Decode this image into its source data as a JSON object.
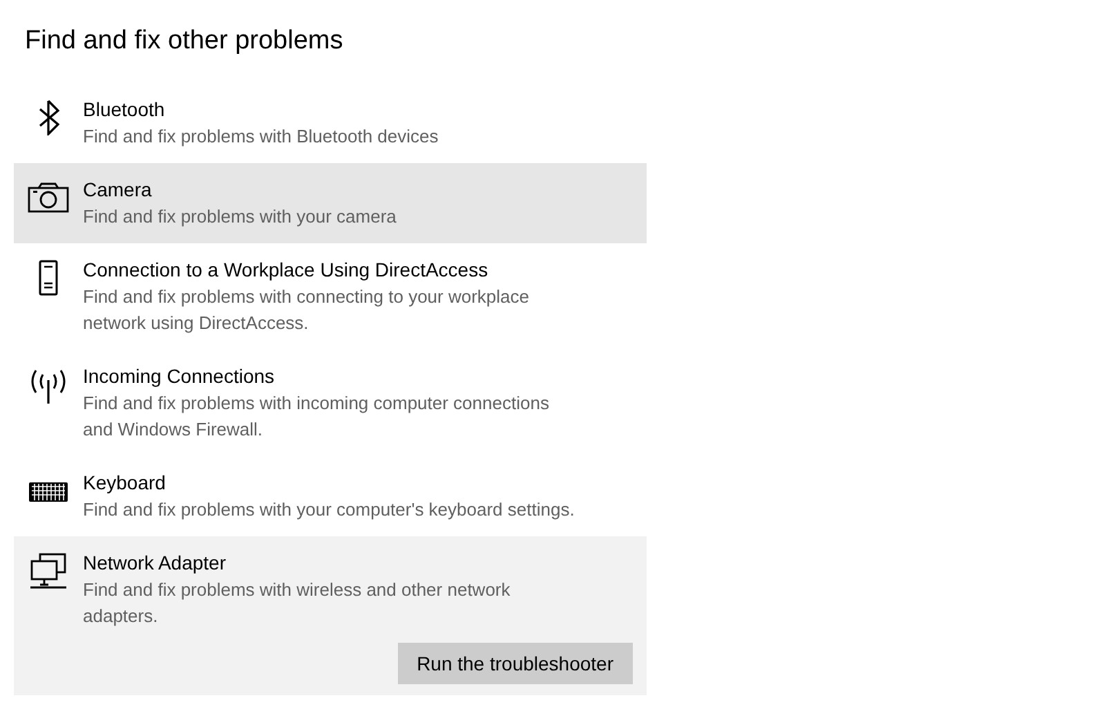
{
  "heading": "Find and fix other problems",
  "items": [
    {
      "kind": "bluetooth",
      "title": "Bluetooth",
      "description": "Find and fix problems with Bluetooth devices",
      "hovered": false,
      "expanded": false
    },
    {
      "kind": "camera",
      "title": "Camera",
      "description": "Find and fix problems with your camera",
      "hovered": true,
      "expanded": false
    },
    {
      "kind": "phone",
      "title": "Connection to a Workplace Using DirectAccess",
      "description": "Find and fix problems with connecting to your workplace network using DirectAccess.",
      "hovered": false,
      "expanded": false
    },
    {
      "kind": "antenna",
      "title": "Incoming Connections",
      "description": "Find and fix problems with incoming computer connections and Windows Firewall.",
      "hovered": false,
      "expanded": false
    },
    {
      "kind": "keyboard",
      "title": "Keyboard",
      "description": "Find and fix problems with your computer's keyboard settings.",
      "hovered": false,
      "expanded": false
    },
    {
      "kind": "network",
      "title": "Network Adapter",
      "description": "Find and fix problems with wireless and other network adapters.",
      "hovered": false,
      "expanded": true,
      "button": "Run the troubleshooter"
    }
  ]
}
